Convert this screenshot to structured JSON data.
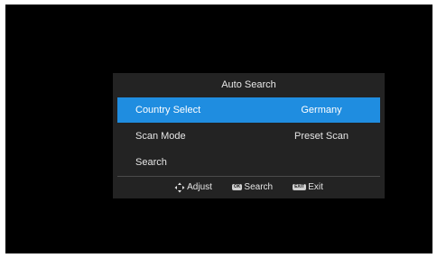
{
  "dialog": {
    "title": "Auto Search"
  },
  "menu": {
    "items": [
      {
        "label": "Country Select",
        "value": "Germany",
        "selected": true
      },
      {
        "label": "Scan Mode",
        "value": "Preset Scan",
        "selected": false
      },
      {
        "label": "Search",
        "value": "",
        "selected": false
      }
    ]
  },
  "footer": {
    "adjust_label": "Adjust",
    "ok_badge": "OK",
    "search_label": "Search",
    "exit_badge": "EXIT",
    "exit_label": "Exit"
  },
  "colors": {
    "selection": "#1f8de0",
    "dialog_bg": "#232323",
    "screen_bg": "#000000"
  },
  "icons": {
    "adjust": "dpad-arrows-icon",
    "ok": "ok-key-icon",
    "exit": "exit-key-icon"
  }
}
